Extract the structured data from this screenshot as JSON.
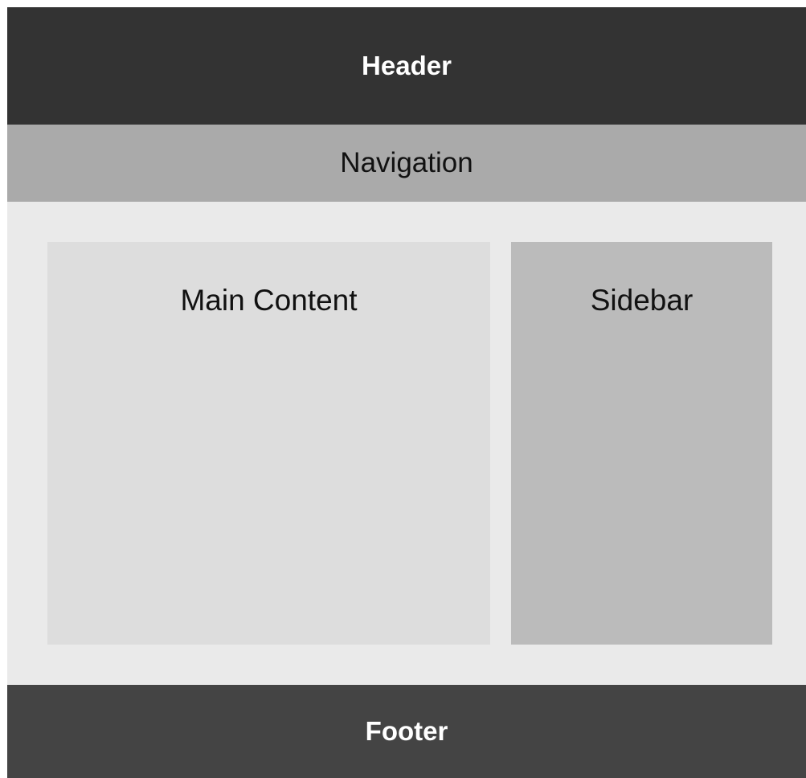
{
  "header": {
    "label": "Header",
    "background": "#333333",
    "text_color": "#ffffff"
  },
  "navigation": {
    "label": "Navigation",
    "background": "#aaaaaa"
  },
  "content_area": {
    "background": "#eaeaea",
    "main": {
      "label": "Main Content",
      "background": "#dddddd"
    },
    "sidebar": {
      "label": "Sidebar",
      "background": "#bbbbbb"
    }
  },
  "footer": {
    "label": "Footer",
    "background": "#444444",
    "text_color": "#ffffff"
  }
}
